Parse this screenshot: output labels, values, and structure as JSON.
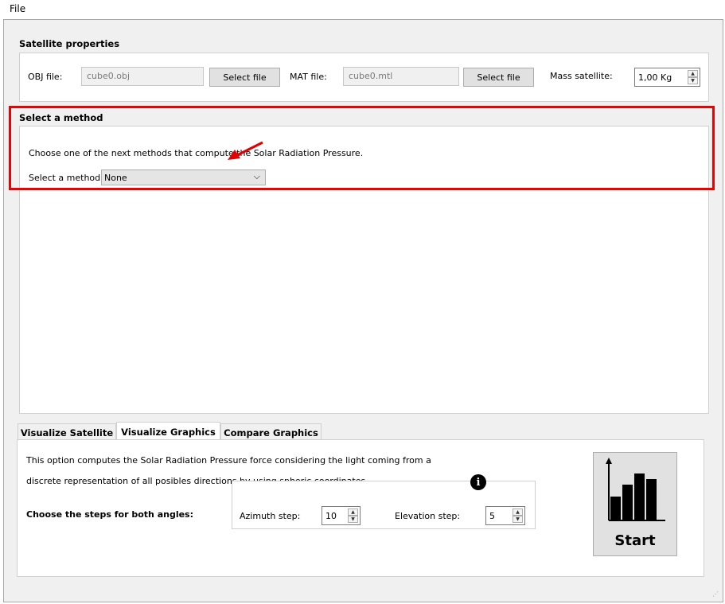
{
  "menu": {
    "file": "File"
  },
  "satellite": {
    "title": "Satellite properties",
    "obj_label": "OBJ file:",
    "obj_value": "cube0.obj",
    "select_file_1": "Select file",
    "mat_label": "MAT file:",
    "mat_value": "cube0.mtl",
    "select_file_2": "Select file",
    "mass_label": "Mass satellite:",
    "mass_value": "1,00 Kg"
  },
  "method": {
    "title": "Select a method",
    "description": "Choose one of the next methods that compute the Solar Radiation Pressure.",
    "select_label": "Select a method:",
    "select_value": "None"
  },
  "tabs": [
    {
      "label": "Visualize Satellite"
    },
    {
      "label": "Visualize Graphics"
    },
    {
      "label": "Compare Graphics"
    }
  ],
  "graphics": {
    "line1": "This option computes the Solar Radiation Pressure force considering the light coming from a",
    "line2": "discrete representation of all posibles directions by using spheric coordinates.",
    "steps_label": "Choose the steps for both angles:",
    "azimuth_label": "Azimuth step:",
    "azimuth_value": "10",
    "elevation_label": "Elevation step:",
    "elevation_value": "5",
    "start_label": "Start"
  },
  "colors": {
    "highlight": "#ee0000",
    "window_bg": "#f0f0f0"
  }
}
